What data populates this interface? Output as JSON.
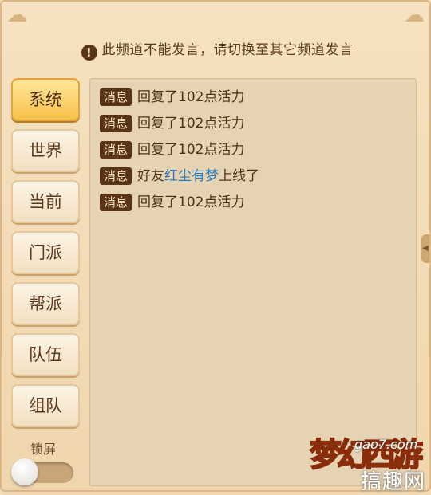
{
  "notice": {
    "icon": "!",
    "text": "此频道不能发言，请切换至其它频道发言"
  },
  "channels": [
    {
      "label": "系统",
      "active": true
    },
    {
      "label": "世界",
      "active": false
    },
    {
      "label": "当前",
      "active": false
    },
    {
      "label": "门派",
      "active": false
    },
    {
      "label": "帮派",
      "active": false
    },
    {
      "label": "队伍",
      "active": false
    },
    {
      "label": "组队",
      "active": false
    }
  ],
  "lock": {
    "label": "锁屏",
    "on": false
  },
  "messages": [
    {
      "tag": "消息",
      "text": "回复了102点活力"
    },
    {
      "tag": "消息",
      "text": "回复了102点活力"
    },
    {
      "tag": "消息",
      "text": "回复了102点活力"
    },
    {
      "tag": "消息",
      "prefix": "好友",
      "player": "红尘有梦",
      "suffix": "上线了"
    },
    {
      "tag": "消息",
      "text": "回复了102点活力"
    }
  ],
  "watermark": {
    "logo": "梦幻西游",
    "site": "gao7.com",
    "cn": "搞趣网"
  },
  "colors": {
    "accent": "#f8c04a",
    "player_name": "#2b7ac0",
    "tag_bg": "#5a3416"
  }
}
